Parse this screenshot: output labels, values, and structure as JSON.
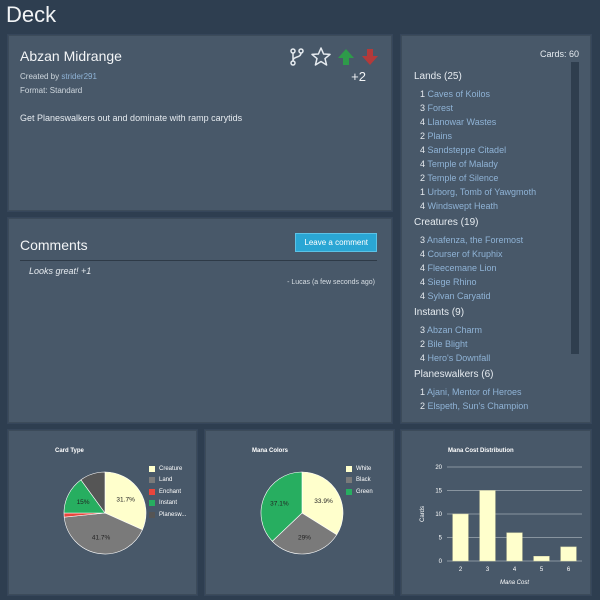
{
  "page": {
    "title": "Deck"
  },
  "deck": {
    "name": "Abzan Midrange",
    "created_prefix": "Created by ",
    "author": "strider291",
    "format_text": "Format: Standard",
    "description": "Get Planeswalkers out and dominate with ramp carytids",
    "votes": "+2",
    "icons": [
      "fork-icon",
      "star-icon",
      "upvote-icon",
      "downvote-icon"
    ]
  },
  "comments": {
    "title": "Comments",
    "button_label": "Leave a comment",
    "items": [
      {
        "text": "Looks great! +1",
        "meta": "- Lucas (a few seconds ago)"
      }
    ]
  },
  "cards": {
    "count_label": "Cards: 60",
    "sections": [
      {
        "title": "Lands (25)",
        "items": [
          {
            "qty": "1",
            "name": "Caves of Koilos"
          },
          {
            "qty": "3",
            "name": "Forest"
          },
          {
            "qty": "4",
            "name": "Llanowar Wastes"
          },
          {
            "qty": "2",
            "name": "Plains"
          },
          {
            "qty": "4",
            "name": "Sandsteppe Citadel"
          },
          {
            "qty": "4",
            "name": "Temple of Malady"
          },
          {
            "qty": "2",
            "name": "Temple of Silence"
          },
          {
            "qty": "1",
            "name": "Urborg, Tomb of Yawgmoth"
          },
          {
            "qty": "4",
            "name": "Windswept Heath"
          }
        ]
      },
      {
        "title": "Creatures (19)",
        "items": [
          {
            "qty": "3",
            "name": "Anafenza, the Foremost"
          },
          {
            "qty": "4",
            "name": "Courser of Kruphix"
          },
          {
            "qty": "4",
            "name": "Fleecemane Lion"
          },
          {
            "qty": "4",
            "name": "Siege Rhino"
          },
          {
            "qty": "4",
            "name": "Sylvan Caryatid"
          }
        ]
      },
      {
        "title": "Instants (9)",
        "items": [
          {
            "qty": "3",
            "name": "Abzan Charm"
          },
          {
            "qty": "2",
            "name": "Bile Blight"
          },
          {
            "qty": "4",
            "name": "Hero's Downfall"
          }
        ]
      },
      {
        "title": "Planeswalkers (6)",
        "items": [
          {
            "qty": "1",
            "name": "Ajani, Mentor of Heroes"
          },
          {
            "qty": "2",
            "name": "Elspeth, Sun's Champion"
          }
        ]
      }
    ]
  },
  "colors": {
    "background": "#2e3e50",
    "panel": "#485869",
    "link": "#8fb3d6",
    "button": "#2aa6d4",
    "upvote": "#2e9a4a",
    "downvote": "#b33a3a"
  },
  "chart_data": [
    {
      "type": "pie",
      "title": "Card Type",
      "legend_position": "right",
      "slices": [
        {
          "label": "Creature",
          "percent": 31.7,
          "color": "#ffffcc",
          "show_label": true
        },
        {
          "label": "Land",
          "percent": 41.7,
          "color": "#7a7a7a",
          "show_label": true
        },
        {
          "label": "Enchant",
          "percent": 1.6,
          "color": "#e8453c",
          "show_label": false
        },
        {
          "label": "Instant",
          "percent": 15,
          "color": "#27ae60",
          "show_label": true
        },
        {
          "label": "Planesw...",
          "percent": 10,
          "color": "#555555",
          "show_label": false
        }
      ]
    },
    {
      "type": "pie",
      "title": "Mana Colors",
      "legend_position": "right",
      "slices": [
        {
          "label": "White",
          "percent": 33.9,
          "color": "#ffffcc",
          "show_label": true
        },
        {
          "label": "Black",
          "percent": 29,
          "color": "#7a7a7a",
          "show_label": true
        },
        {
          "label": "Green",
          "percent": 37.1,
          "color": "#27ae60",
          "show_label": true
        }
      ]
    },
    {
      "type": "bar",
      "title": "Mana Cost Distribution",
      "categories": [
        "2",
        "3",
        "4",
        "5",
        "6"
      ],
      "values": [
        10,
        15,
        6,
        1,
        3
      ],
      "xlabel": "Mana Cost",
      "ylabel": "Cards",
      "ylim": [
        0,
        20
      ],
      "yticks": [
        "0",
        "5",
        "10",
        "15",
        "20"
      ],
      "bar_color": "#ffffcc",
      "grid": true
    }
  ]
}
